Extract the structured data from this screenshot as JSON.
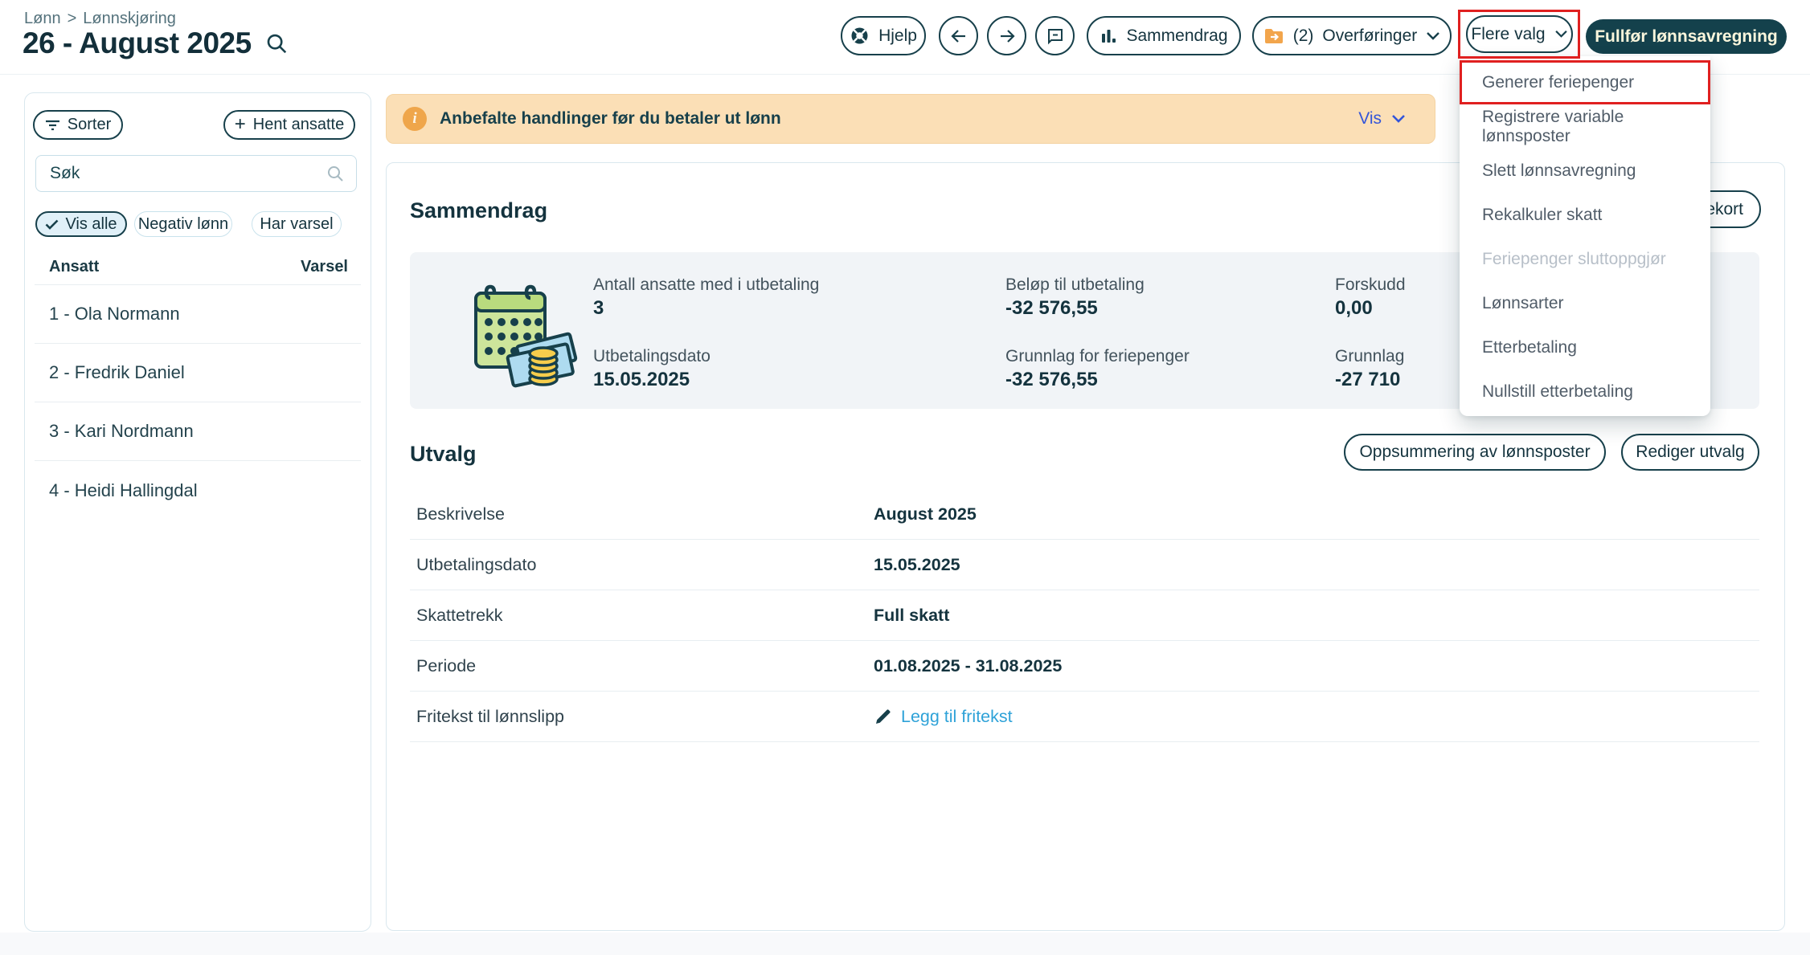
{
  "colors": {
    "accent_teal": "#17404B",
    "dark_button_bg": "#14414C",
    "dark_button_text": "#FAF6DC",
    "banner_bg": "#FBDFB6",
    "banner_icon": "#EFA64B",
    "vis_link_blue": "#3355D9",
    "light_link_blue": "#2EA2D8",
    "highlight_red": "#E02020",
    "summary_box_bg": "#F1F4F7"
  },
  "icons": {
    "help": "life-buoy-icon",
    "back": "arrow-left-icon",
    "forward": "arrow-right-icon",
    "comment": "speech-bubble-icon",
    "summary": "bar-chart-icon",
    "transfers": "folder-arrow-icon",
    "search": "magnifier-icon",
    "sort": "filter-lines-icon",
    "edit": "pencil-icon",
    "calendar": "calendar-money-illustration"
  },
  "breadcrumb": {
    "part1": "Lønn",
    "separator": ">",
    "part2": "Lønnskjøring"
  },
  "page_title": "26 - August 2025",
  "topbar": {
    "help_label": "Hjelp",
    "summary_label": "Sammendrag",
    "transfers_count": "(2)",
    "transfers_label": "Overføringer",
    "more_options_label": "Flere valg",
    "complete_label": "Fullfør lønnsavregning"
  },
  "dropdown": {
    "items": [
      {
        "label": "Generer feriepenger",
        "highlighted": true,
        "disabled": false
      },
      {
        "label": "Registrere variable lønnsposter",
        "highlighted": false,
        "disabled": false
      },
      {
        "label": "Slett lønnsavregning",
        "highlighted": false,
        "disabled": false
      },
      {
        "label": "Rekalkuler skatt",
        "highlighted": false,
        "disabled": false
      },
      {
        "label": "Feriepenger sluttoppgjør",
        "highlighted": false,
        "disabled": true
      },
      {
        "label": "Lønnsarter",
        "highlighted": false,
        "disabled": false
      },
      {
        "label": "Etterbetaling",
        "highlighted": false,
        "disabled": false
      },
      {
        "label": "Nullstill etterbetaling",
        "highlighted": false,
        "disabled": false
      }
    ]
  },
  "sidebar": {
    "sort_label": "Sorter",
    "fetch_plus": "+",
    "fetch_label": "Hent ansatte",
    "search_placeholder": "Søk",
    "filters": [
      {
        "label": "Vis alle",
        "active": true
      },
      {
        "label": "Negativ lønn",
        "active": false
      },
      {
        "label": "Har varsel",
        "active": false
      }
    ],
    "columns": {
      "employee": "Ansatt",
      "warning": "Varsel"
    },
    "employees": [
      "1 - Ola Normann",
      "2 - Fredrik Daniel",
      "3 - Kari Nordmann",
      "4 - Heidi Hallingdal"
    ]
  },
  "banner": {
    "text": "Anbefalte handlinger før du betaler ut lønn",
    "action_label": "Vis"
  },
  "summary": {
    "heading": "Sammendrag",
    "partial_button_label": "ekort",
    "stats": [
      {
        "label": "Antall ansatte med i utbetaling",
        "value": "3"
      },
      {
        "label": "Utbetalingsdato",
        "value": "15.05.2025"
      },
      {
        "label": "Beløp til utbetaling",
        "value": "-32 576,55"
      },
      {
        "label": "Grunnlag for feriepenger",
        "value": "-32 576,55"
      },
      {
        "label": "Forskudd",
        "value": "0,00"
      },
      {
        "label": "Grunnlag",
        "value": "-27 710"
      }
    ]
  },
  "selection": {
    "heading": "Utvalg",
    "buttons": [
      "Oppsummering av lønnsposter",
      "Rediger utvalg"
    ],
    "rows": [
      {
        "label": "Beskrivelse",
        "value": "August 2025",
        "is_link": false
      },
      {
        "label": "Utbetalingsdato",
        "value": "15.05.2025",
        "is_link": false
      },
      {
        "label": "Skattetrekk",
        "value": "Full skatt",
        "is_link": false
      },
      {
        "label": "Periode",
        "value": "01.08.2025 - 31.08.2025",
        "is_link": false
      },
      {
        "label": "Fritekst til lønnslipp",
        "value": "Legg til fritekst",
        "is_link": true
      }
    ]
  }
}
